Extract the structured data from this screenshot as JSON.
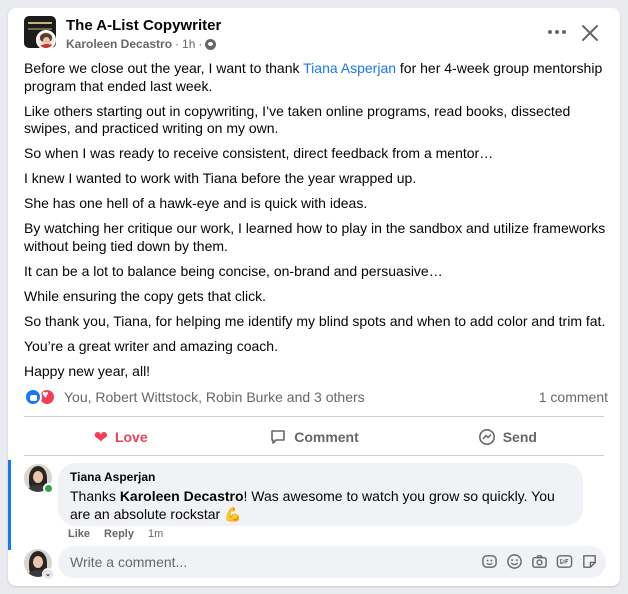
{
  "header": {
    "group_name": "The A-List Copywriter",
    "author": "Karoleen Decastro",
    "time": "1h",
    "separator": "·",
    "privacy_icon": "globe-icon",
    "more_icon": "more-horizontal-icon",
    "close_icon": "close-icon"
  },
  "post": {
    "p1_before": "Before we close out the year, I want to thank ",
    "p1_mention": "Tiana Asperjan",
    "p1_after": " for her 4-week group mentorship program that ended last week.",
    "paragraphs": [
      "Like others starting out in copywriting, I’ve taken online programs, read books, dissected swipes, and practiced writing on my own.",
      "So when I was ready to receive consistent, direct feedback from a mentor…",
      "I knew I wanted to work with Tiana before the year wrapped up.",
      "She has one hell of a hawk-eye and is quick with ideas.",
      "By watching her critique our work, I learned how to play in the sandbox and utilize frameworks without being tied down by them.",
      "It can be a lot to balance being concise, on-brand and persuasive…",
      "While ensuring the copy gets that click.",
      "So thank you, Tiana, for helping me identify my blind spots and when to add color and trim fat.",
      "You’re a great writer and amazing coach.",
      "Happy new year, all!"
    ]
  },
  "reactions": {
    "reactors": "You, Robert Wittstock, Robin Burke and 3 others",
    "comment_count": "1 comment"
  },
  "actions": {
    "love": "Love",
    "comment": "Comment",
    "send": "Send"
  },
  "comment": {
    "author": "Tiana Asperjan",
    "text_before": "Thanks ",
    "text_bold": "Karoleen Decastro",
    "text_after": "! Was awesome to watch you grow so quickly. You are an absolute rockstar ",
    "emoji": "💪",
    "like": "Like",
    "reply": "Reply",
    "time": "1m"
  },
  "composer": {
    "placeholder": "Write a comment...",
    "chevron": "⌄"
  },
  "colors": {
    "accent": "#1877f2",
    "love": "#f33e58",
    "muted": "#65676b"
  }
}
